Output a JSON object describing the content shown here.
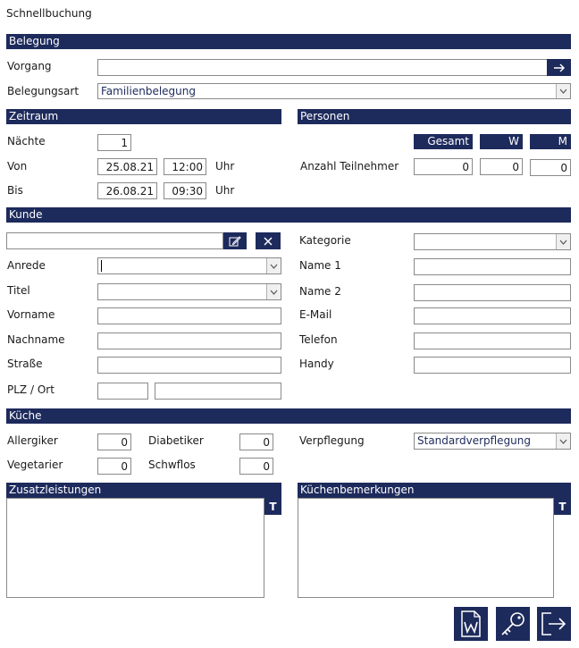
{
  "window": {
    "title": "Schnellbuchung"
  },
  "belegung": {
    "header": "Belegung",
    "vorgang_label": "Vorgang",
    "vorgang_value": "",
    "belegungsart_label": "Belegungsart",
    "belegungsart_value": "Familienbelegung"
  },
  "zeitraum": {
    "header": "Zeitraum",
    "naechte_label": "Nächte",
    "naechte_value": "1",
    "von_label": "Von",
    "von_date": "25.08.21",
    "von_time": "12:00",
    "bis_label": "Bis",
    "bis_date": "26.08.21",
    "bis_time": "09:30",
    "uhr_label": "Uhr"
  },
  "personen": {
    "header": "Personen",
    "col_gesamt": "Gesamt",
    "col_w": "W",
    "col_m": "M",
    "anzahl_label": "Anzahl Teilnehmer",
    "gesamt_value": "0",
    "w_value": "0",
    "m_value": "0"
  },
  "kunde": {
    "header": "Kunde",
    "search_value": "",
    "anrede_label": "Anrede",
    "anrede_value": "",
    "titel_label": "Titel",
    "titel_value": "",
    "vorname_label": "Vorname",
    "nachname_label": "Nachname",
    "strasse_label": "Straße",
    "plzort_label": "PLZ / Ort",
    "kategorie_label": "Kategorie",
    "kategorie_value": "",
    "name1_label": "Name 1",
    "name2_label": "Name 2",
    "email_label": "E-Mail",
    "telefon_label": "Telefon",
    "handy_label": "Handy"
  },
  "kueche": {
    "header": "Küche",
    "allergiker_label": "Allergiker",
    "allergiker_value": "0",
    "diabetiker_label": "Diabetiker",
    "diabetiker_value": "0",
    "vegetarier_label": "Vegetarier",
    "vegetarier_value": "0",
    "schwflos_label": "Schwflos",
    "schwflos_value": "0",
    "verpflegung_label": "Verpflegung",
    "verpflegung_value": "Standardverpflegung"
  },
  "zusatz": {
    "header": "Zusatzleistungen",
    "t_label": "T"
  },
  "kuechenbemerkungen": {
    "header": "Küchenbemerkungen",
    "t_label": "T"
  },
  "icons": {
    "arrow": "arrow-right-icon",
    "edit": "edit-icon",
    "clear": "close-icon",
    "word": "word-document-icon",
    "key": "key-icon",
    "exit": "exit-icon"
  },
  "colors": {
    "accent": "#1d2a5c"
  }
}
